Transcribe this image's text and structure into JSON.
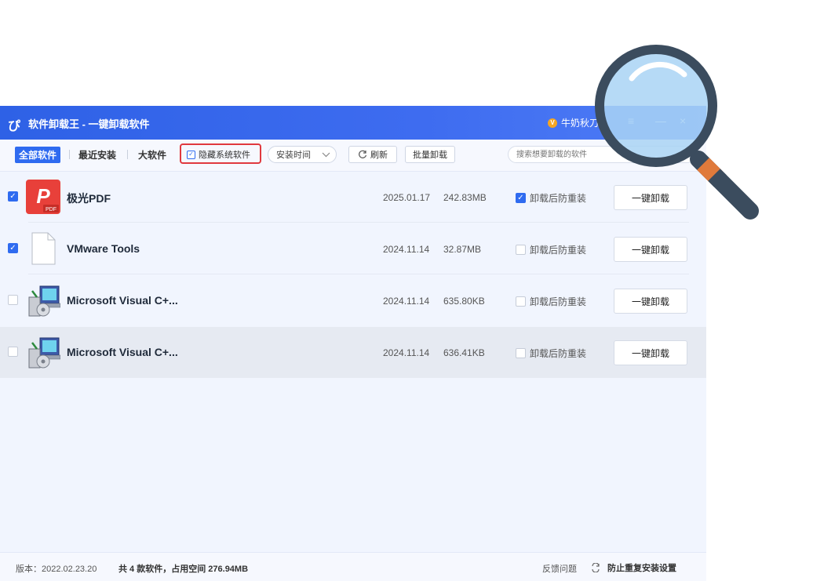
{
  "app": {
    "logo": "ぴ",
    "title": "软件卸载王 - 一键卸载软件",
    "user": "牛奶秋刀",
    "controls": [
      "≡",
      "—",
      "×"
    ]
  },
  "toolbar": {
    "tabs": [
      "全部软件",
      "最近安装",
      "大软件"
    ],
    "hide_system_label": "隐藏系统软件",
    "sort_label": "安装时间",
    "refresh_label": "刷新",
    "batch_label": "批量卸载",
    "search_placeholder": "搜索想要卸载的软件"
  },
  "apps": [
    {
      "name": "极光PDF",
      "date": "2025.01.17",
      "size": "242.83MB",
      "selected": true,
      "reinstall": true,
      "reinstall_label": "卸载后防重装",
      "action": "一键卸载"
    },
    {
      "name": "VMware Tools",
      "date": "2024.11.14",
      "size": "32.87MB",
      "selected": true,
      "reinstall": false,
      "reinstall_label": "卸载后防重装",
      "action": "一键卸载"
    },
    {
      "name": "Microsoft Visual C+...",
      "date": "2024.11.14",
      "size": "635.80KB",
      "selected": false,
      "reinstall": false,
      "reinstall_label": "卸载后防重装",
      "action": "一键卸载"
    },
    {
      "name": "Microsoft Visual C+...",
      "date": "2024.11.14",
      "size": "636.41KB",
      "selected": false,
      "reinstall": false,
      "reinstall_label": "卸载后防重装",
      "action": "一键卸载"
    }
  ],
  "status": {
    "version": "版本：2022.02.23.20",
    "summary": "共 4 款软件，占用空间 276.94MB",
    "feedback": "反馈问题",
    "prevent": "防止重复安装设置"
  },
  "colors": {
    "accent": "#2f6bf0",
    "title_bar": "#3e6cf0",
    "highlight_border": "#e0393e",
    "pdf_red": "#e8403a"
  },
  "icons": [
    "app-logo-icon",
    "vip-icon",
    "menu-icon",
    "minimize-icon",
    "close-icon",
    "checkbox-icon",
    "chevron-down-icon",
    "refresh-icon",
    "pdf-app-icon",
    "blank-file-icon",
    "installer-icon",
    "toggle-icon",
    "magnifier-icon"
  ]
}
